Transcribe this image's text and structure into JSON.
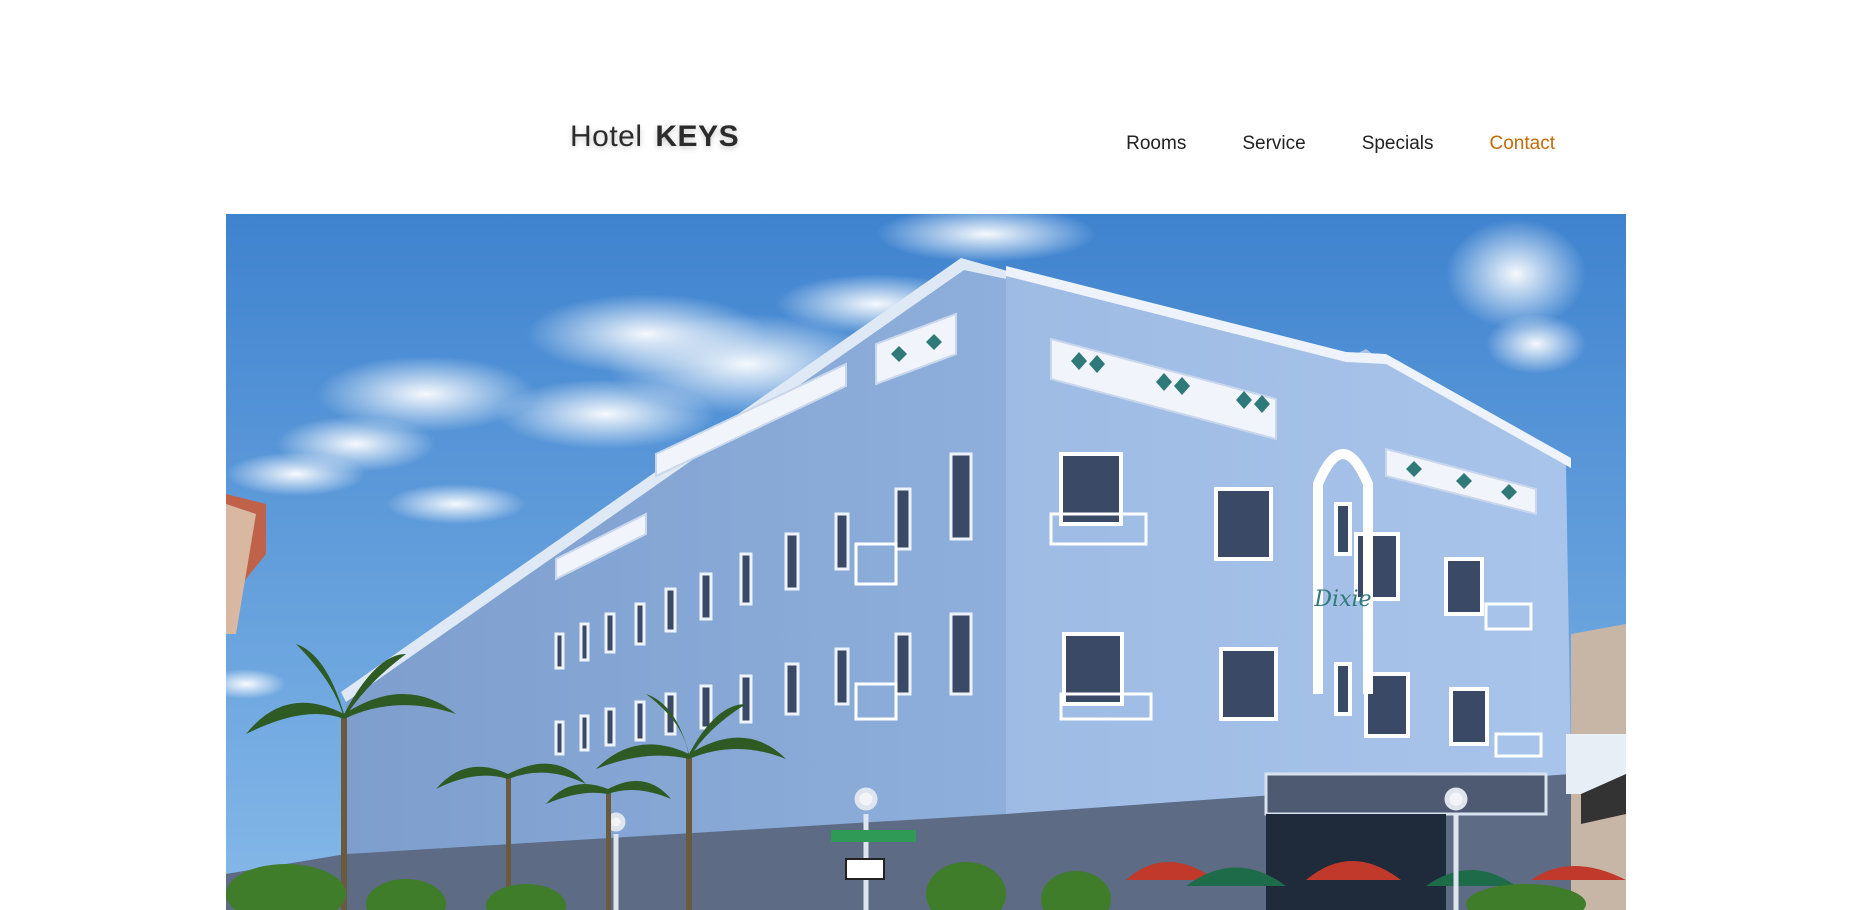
{
  "header": {
    "logo_light": "Hotel",
    "logo_bold": "KEYS"
  },
  "nav": {
    "items": [
      {
        "label": "Rooms",
        "active": false
      },
      {
        "label": "Service",
        "active": false
      },
      {
        "label": "Specials",
        "active": false
      },
      {
        "label": "Contact",
        "active": true
      }
    ]
  },
  "hero": {
    "image": "hotel-building-photo",
    "sign_text": "Dixie"
  },
  "colors": {
    "accent": "#c46a05",
    "text": "#222222",
    "sky": "#4f8ed4",
    "building": "#8fb0dc"
  }
}
